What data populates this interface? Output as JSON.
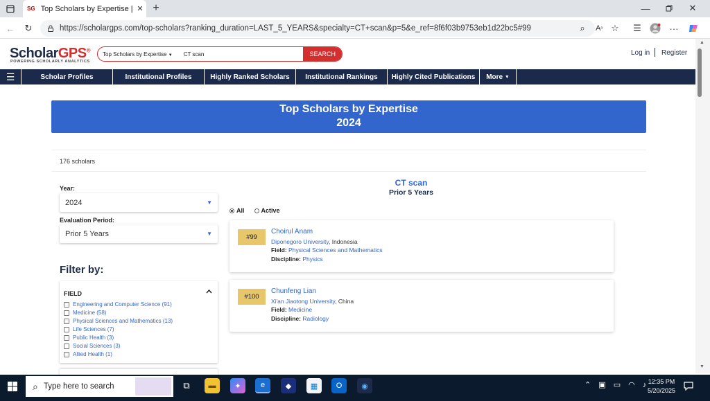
{
  "browser": {
    "tab_title": "Top Scholars by Expertise | Schola",
    "tab_favicon": "SG",
    "url": "https://scholargps.com/top-scholars?ranking_duration=LAST_5_YEARS&specialty=CT+scan&p=5&e_ref=8f6f03b9753eb1d22bc5#99"
  },
  "site": {
    "logo_main": "Scholar",
    "logo_accent": "GPS",
    "logo_mark": "®",
    "tagline": "POWERING SCHOLARLY ANALYTICS",
    "search_type": "Top Scholars by Expertise",
    "search_value": "CT scan",
    "search_button": "SEARCH",
    "login": "Log in",
    "register": "Register"
  },
  "nav": [
    "Scholar Profiles",
    "Institutional Profiles",
    "Highly Ranked Scholars",
    "Institutional Rankings",
    "Highly Cited Publications",
    "More"
  ],
  "banner": {
    "title": "Top Scholars by Expertise",
    "year": "2024"
  },
  "count": "176 scholars",
  "filters": {
    "year_label": "Year:",
    "year_value": "2024",
    "period_label": "Evaluation Period:",
    "period_value": "Prior 5 Years",
    "filter_heading": "Filter by:",
    "field_heading": "FIELD",
    "fields": [
      "Engineering and Computer Science (91)",
      "Medicine (58)",
      "Physical Sciences and Mathematics (13)",
      "Life Sciences (7)",
      "Public Health (3)",
      "Social Sciences (3)",
      "Allied Health (1)"
    ]
  },
  "results": {
    "specialty": "CT scan",
    "duration": "Prior 5 Years",
    "radio_all": "All",
    "radio_active": "Active",
    "field_label": "Field:",
    "discipline_label": "Discipline:",
    "scholars": [
      {
        "rank": "#99",
        "name": "Choirul Anam",
        "institution": "Diponegoro University",
        "country": ", Indonesia",
        "field": "Physical Sciences and Mathematics",
        "discipline": "Physics"
      },
      {
        "rank": "#100",
        "name": "Chunfeng Lian",
        "institution": "Xi'an Jiaotong University",
        "country": ", China",
        "field": "Medicine",
        "discipline": "Radiology"
      }
    ]
  },
  "taskbar": {
    "search_placeholder": "Type here to search",
    "time": "12:35 PM",
    "date": "5/20/2025"
  }
}
